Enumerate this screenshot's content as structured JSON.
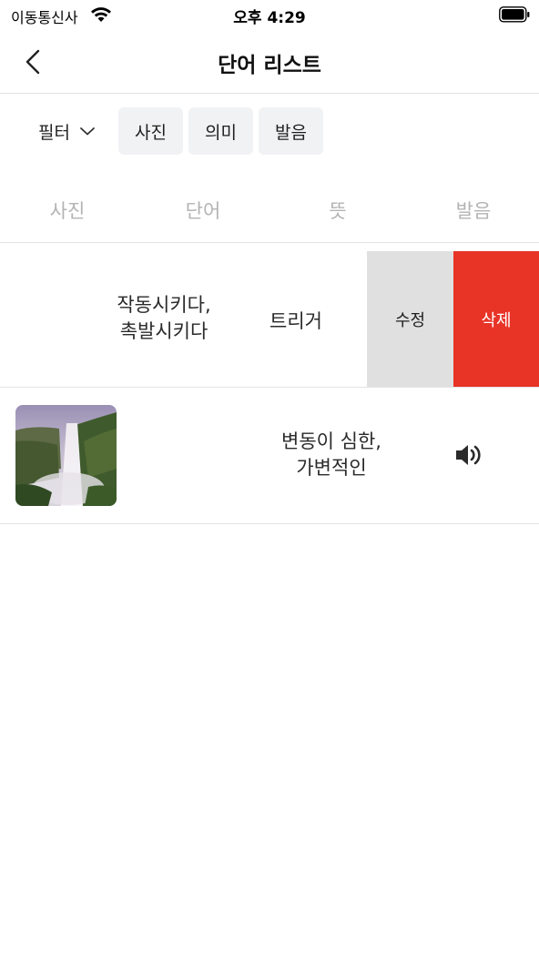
{
  "status_bar": {
    "carrier": "이동통신사",
    "time": "오후 4:29"
  },
  "nav": {
    "title": "단어 리스트"
  },
  "filter_bar": {
    "filter_label": "필터",
    "chips": [
      "사진",
      "의미",
      "발음"
    ]
  },
  "table": {
    "headers": [
      "사진",
      "단어",
      "뜻",
      "발음"
    ],
    "rows": [
      {
        "meaning_line1": "작동시키다,",
        "meaning_line2": "촉발시키다",
        "word": "트리거",
        "edit_label": "수정",
        "delete_label": "삭제"
      },
      {
        "photo": "waterfall",
        "meaning_line1": "변동이 심한,",
        "meaning_line2": "가변적인",
        "pronunciation_icon": "speaker-icon"
      }
    ]
  },
  "colors": {
    "delete": "#e83327",
    "edit": "#e0e0e0",
    "chip": "#f1f2f4",
    "header_text": "#b3b3b3"
  }
}
